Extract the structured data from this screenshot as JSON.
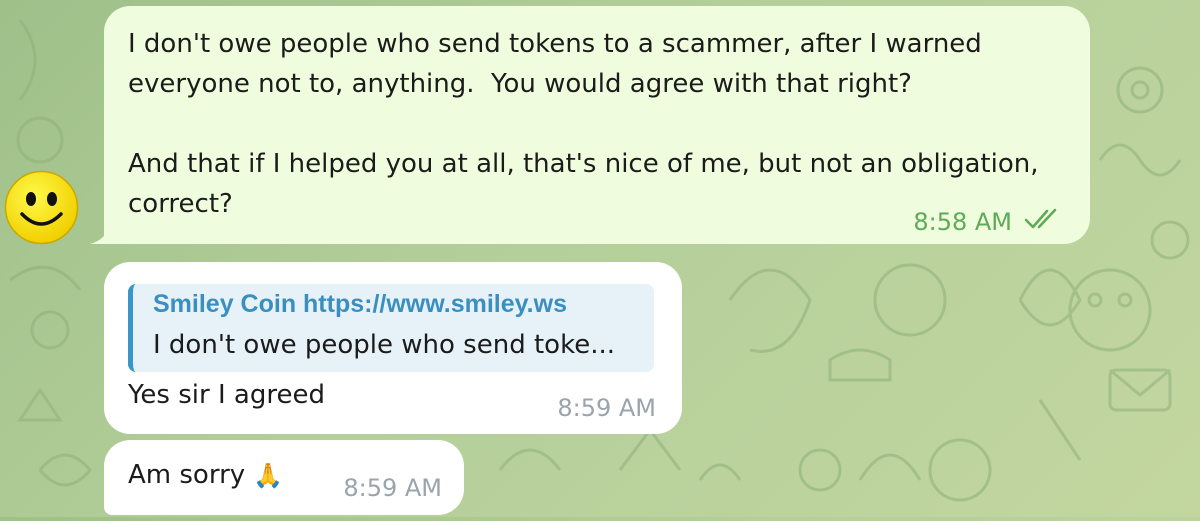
{
  "messages": {
    "outgoing": {
      "text": "I don't owe people who send tokens to a scammer, after I warned everyone not to, anything.  You would agree with that right?\n\nAnd that if I helped you at all, that's nice of me, but not an obligation, correct?",
      "time": "8:58 AM",
      "status_icon": "double-check-icon"
    },
    "incoming_1": {
      "reply_to_name": "Smiley Coin https://www.smiley.ws",
      "reply_to_text": "I don't owe people who send toke...",
      "text": "Yes sir I agreed",
      "time": "8:59 AM"
    },
    "incoming_2": {
      "text": "Am sorry",
      "emoji": "🙏",
      "time": "8:59 AM"
    }
  },
  "colors": {
    "outgoing_bubble": "#effdde",
    "incoming_bubble": "#ffffff",
    "reply_accent": "#3a95c8",
    "time_out": "#5faa57",
    "time_in": "#9aa4ad"
  }
}
